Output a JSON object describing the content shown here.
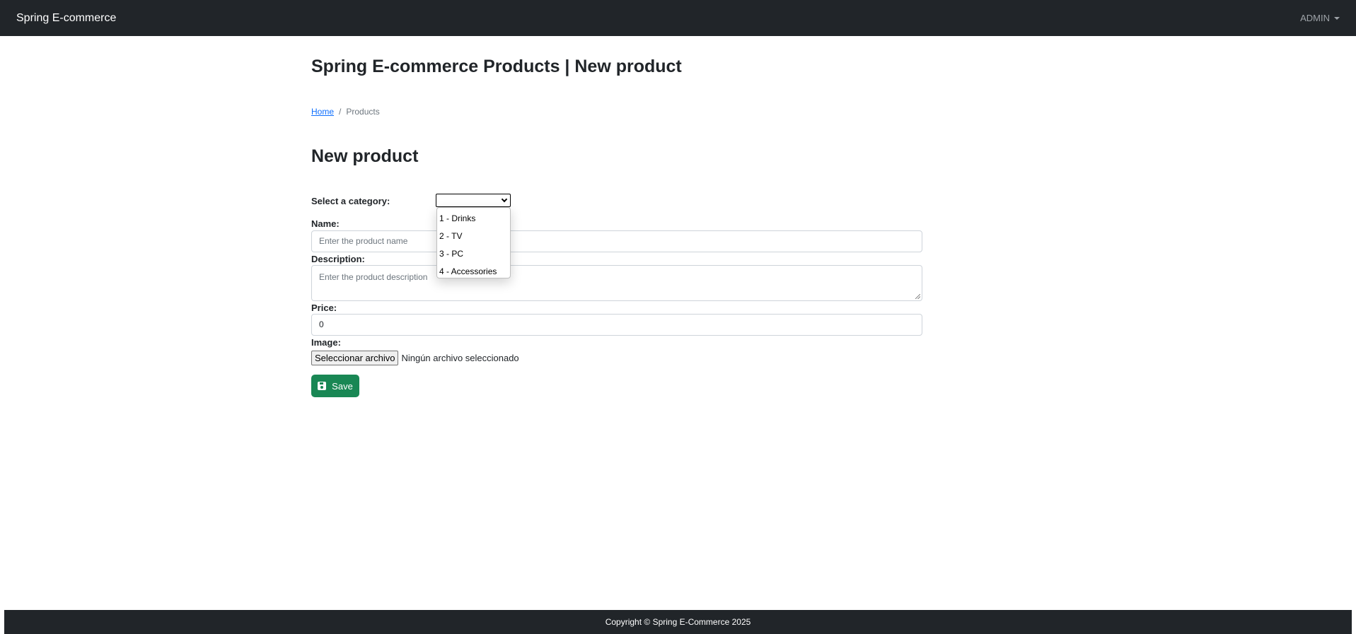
{
  "navbar": {
    "brand": "Spring E-commerce",
    "user_menu": "ADMIN"
  },
  "page": {
    "title": "Spring E-commerce Products | New product"
  },
  "breadcrumb": {
    "home": "Home",
    "separator": "/",
    "current": "Products"
  },
  "form": {
    "heading": "New product",
    "category_label": "Select a category:",
    "category_selected": "",
    "category_options": [
      "1 - Drinks",
      "2 - TV",
      "3 - PC",
      "4 - Accessories"
    ],
    "name_label": "Name:",
    "name_placeholder": "Enter the product name",
    "description_label": "Description:",
    "description_placeholder": "Enter the product description",
    "price_label": "Price:",
    "price_value": "0",
    "image_label": "Image:",
    "file_button": "Seleccionar archivo",
    "file_status": "Ningún archivo seleccionado",
    "save_label": "Save",
    "save_icon": "floppy-disk-icon"
  },
  "footer": {
    "text": "Copyright © Spring E-Commerce 2025"
  },
  "colors": {
    "navbar": "#212529",
    "save_button": "#198754",
    "link": "#0d6efd"
  }
}
